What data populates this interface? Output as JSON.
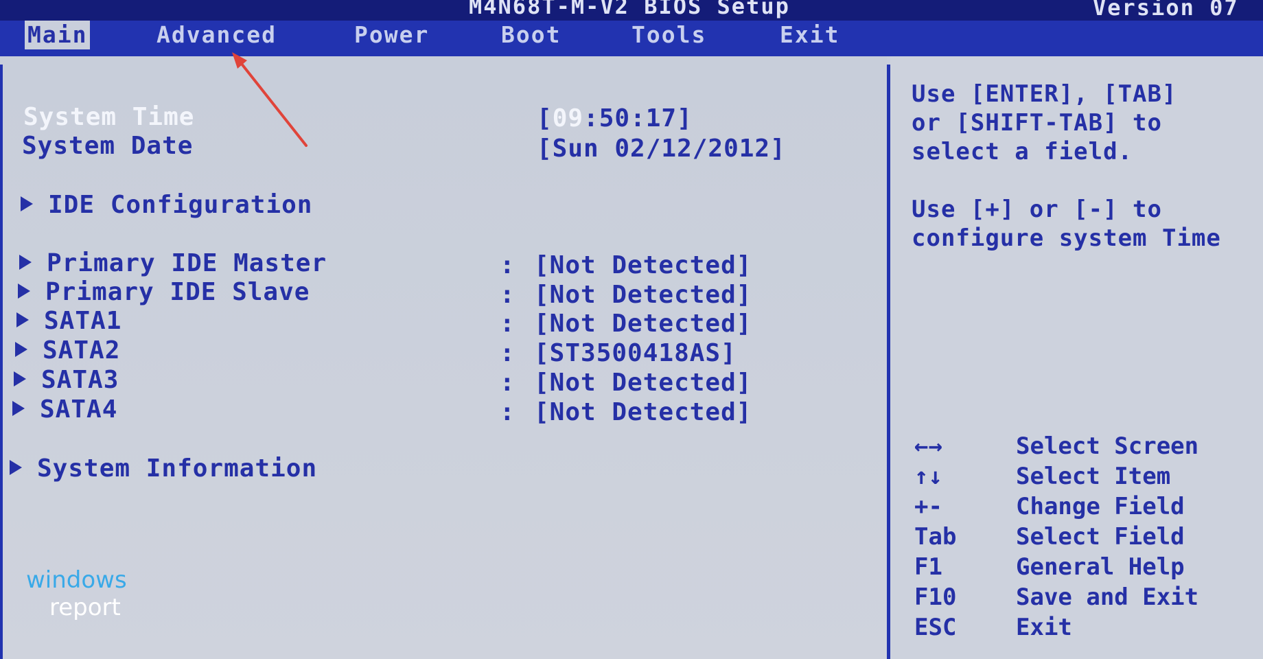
{
  "header": {
    "title": "M4N68T-M-V2 BIOS Setup",
    "version": "Version 07"
  },
  "menu": [
    {
      "label": "Main",
      "active": true
    },
    {
      "label": "Advanced",
      "active": false
    },
    {
      "label": "Power",
      "active": false
    },
    {
      "label": "Boot",
      "active": false
    },
    {
      "label": "Tools",
      "active": false
    },
    {
      "label": "Exit",
      "active": false
    }
  ],
  "main": {
    "system_time": {
      "label": "System Time",
      "value_open": "[",
      "value_selected": "09",
      "value_rest": ":50:17]"
    },
    "system_date": {
      "label": "System Date",
      "value": "[Sun 02/12/2012]"
    },
    "ide_configuration": "IDE Configuration",
    "drives": [
      {
        "label": "Primary IDE Master",
        "value": "[Not Detected]"
      },
      {
        "label": "Primary IDE Slave",
        "value": "[Not Detected]"
      },
      {
        "label": "SATA1",
        "value": "[Not Detected]"
      },
      {
        "label": "SATA2",
        "value": "[ST3500418AS]"
      },
      {
        "label": "SATA3",
        "value": "[Not Detected]"
      },
      {
        "label": "SATA4",
        "value": "[Not Detected]"
      }
    ],
    "separator": ":",
    "system_information": "System Information"
  },
  "help": {
    "line1": "Use [ENTER], [TAB]",
    "line2": "or [SHIFT-TAB] to",
    "line3": "select a field.",
    "line4": "Use [+] or [-] to",
    "line5": "configure system Time"
  },
  "keys": [
    {
      "key": "←→",
      "action": "Select Screen"
    },
    {
      "key": "↑↓",
      "action": "Select Item"
    },
    {
      "key": "+-",
      "action": "Change Field"
    },
    {
      "key": "Tab",
      "action": "Select Field"
    },
    {
      "key": "F1",
      "action": "General Help"
    },
    {
      "key": "F10",
      "action": "Save and Exit"
    },
    {
      "key": "ESC",
      "action": "Exit"
    }
  ],
  "watermark": {
    "line1": "windows",
    "line2": "report"
  },
  "colors": {
    "bios_blue": "#2233b0",
    "panel_gray": "#c9cfdc",
    "text_blue": "#2530a6",
    "highlight_white": "#f3f5fb",
    "annotation_red": "#e0443a"
  }
}
